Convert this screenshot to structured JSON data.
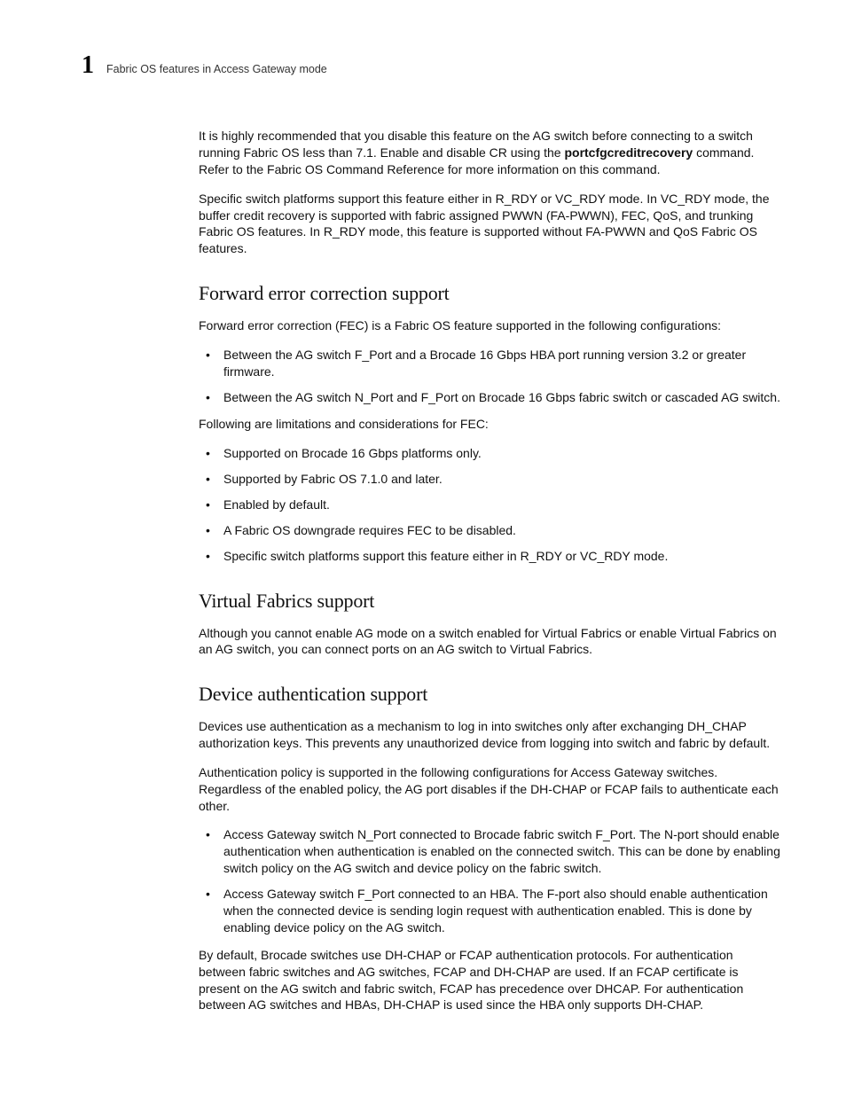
{
  "header": {
    "chapter_number": "1",
    "running_title": "Fabric OS features in Access Gateway mode"
  },
  "intro": {
    "p1_a": "It is highly recommended that you disable this feature on the AG switch before connecting to a switch running Fabric OS less than 7.1. Enable and disable CR using the ",
    "p1_cmd": "portcfgcreditrecovery",
    "p1_b": " command. Refer to the Fabric OS Command Reference for more information on this command.",
    "p2": "Specific switch platforms support this feature either in R_RDY or VC_RDY mode. In VC_RDY mode, the buffer credit recovery is supported with fabric assigned PWWN (FA-PWWN), FEC, QoS, and trunking Fabric OS features. In R_RDY mode, this feature is supported without FA-PWWN and QoS Fabric OS features."
  },
  "fec": {
    "heading": "Forward error correction support",
    "p1": "Forward error correction (FEC) is a Fabric OS feature supported in the following configurations:",
    "config_bullets": [
      "Between the AG switch F_Port and a Brocade 16 Gbps HBA port running version 3.2 or greater firmware.",
      "Between the AG switch N_Port and F_Port on Brocade 16 Gbps fabric switch or cascaded AG switch."
    ],
    "p2": "Following are limitations and considerations for FEC:",
    "limit_bullets": [
      "Supported on Brocade 16 Gbps platforms only.",
      "Supported by Fabric OS 7.1.0 and later.",
      "Enabled by default.",
      "A Fabric OS downgrade requires FEC to be disabled.",
      "Specific switch platforms support this feature either in R_RDY or VC_RDY mode."
    ]
  },
  "vf": {
    "heading": "Virtual Fabrics support",
    "p1": "Although you cannot enable AG mode on a switch enabled for Virtual Fabrics or enable Virtual Fabrics on an AG switch, you can connect ports on an AG switch to Virtual Fabrics."
  },
  "auth": {
    "heading": "Device authentication support",
    "p1": "Devices use authentication as a mechanism to log in into switches only after exchanging DH_CHAP authorization keys. This prevents any unauthorized device from logging into switch and fabric by default.",
    "p2": "Authentication policy is supported in the following configurations for Access Gateway switches. Regardless of the enabled policy, the AG port disables if the DH-CHAP or FCAP fails to authenticate each other.",
    "bullets": [
      "Access Gateway switch N_Port connected to Brocade fabric switch F_Port. The N-port should enable authentication when authentication is enabled on the connected switch. This can be done by enabling switch policy on the AG switch and device policy on the fabric switch.",
      "Access Gateway switch F_Port connected to an HBA. The F-port also should enable authentication when the connected device is sending login request with authentication enabled. This is done by enabling device policy on the AG switch."
    ],
    "p3": "By default, Brocade switches use DH-CHAP or FCAP authentication protocols. For authentication between fabric switches and AG switches, FCAP and DH-CHAP are used. If an FCAP certificate is present on the AG switch and fabric switch, FCAP has precedence over DHCAP. For authentication between AG switches and HBAs, DH-CHAP is used since the HBA only supports DH-CHAP."
  }
}
